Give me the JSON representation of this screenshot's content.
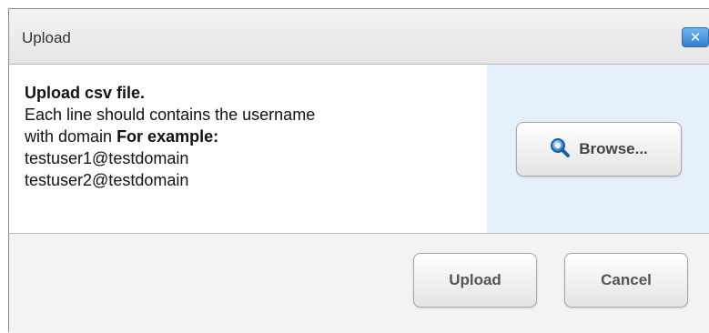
{
  "dialog": {
    "title": "Upload",
    "close_label": "✕"
  },
  "instructions": {
    "heading": "Upload csv file.",
    "line1": "Each line should contains the username",
    "line2_prefix": "with domain ",
    "line2_bold": "For example:",
    "example1": "testuser1@testdomain",
    "example2": "testuser2@testdomain"
  },
  "browse": {
    "icon": "search-icon",
    "label": "Browse..."
  },
  "footer": {
    "upload_label": "Upload",
    "cancel_label": "Cancel"
  },
  "colors": {
    "accent": "#2f80d1",
    "browse_panel_bg": "#e6f0fb",
    "footer_bg": "#f3f3f3"
  }
}
